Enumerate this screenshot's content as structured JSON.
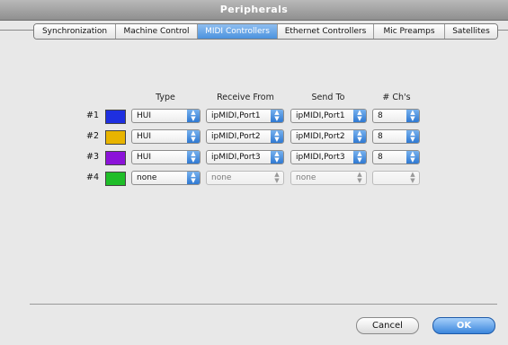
{
  "window": {
    "title": "Peripherals"
  },
  "tabs": [
    {
      "label": "Synchronization",
      "active": false
    },
    {
      "label": "Machine Control",
      "active": false
    },
    {
      "label": "MIDI Controllers",
      "active": true
    },
    {
      "label": "Ethernet Controllers",
      "active": false
    },
    {
      "label": "Mic Preamps",
      "active": false
    },
    {
      "label": "Satellites",
      "active": false
    }
  ],
  "columns": {
    "type": "Type",
    "receive": "Receive From",
    "send": "Send To",
    "chs": "# Ch's"
  },
  "rows": [
    {
      "label": "#1",
      "color": "#1e2fe0",
      "type": "HUI",
      "receive": "ipMIDI,Port1",
      "send": "ipMIDI,Port1",
      "chs": "8"
    },
    {
      "label": "#2",
      "color": "#e8b400",
      "type": "HUI",
      "receive": "ipMIDI,Port2",
      "send": "ipMIDI,Port2",
      "chs": "8"
    },
    {
      "label": "#3",
      "color": "#8b12d8",
      "type": "HUI",
      "receive": "ipMIDI,Port3",
      "send": "ipMIDI,Port3",
      "chs": "8"
    },
    {
      "label": "#4",
      "color": "#1fbd28",
      "type": "none",
      "receive": "none",
      "send": "none",
      "chs": ""
    }
  ],
  "buttons": {
    "cancel": "Cancel",
    "ok": "OK"
  }
}
